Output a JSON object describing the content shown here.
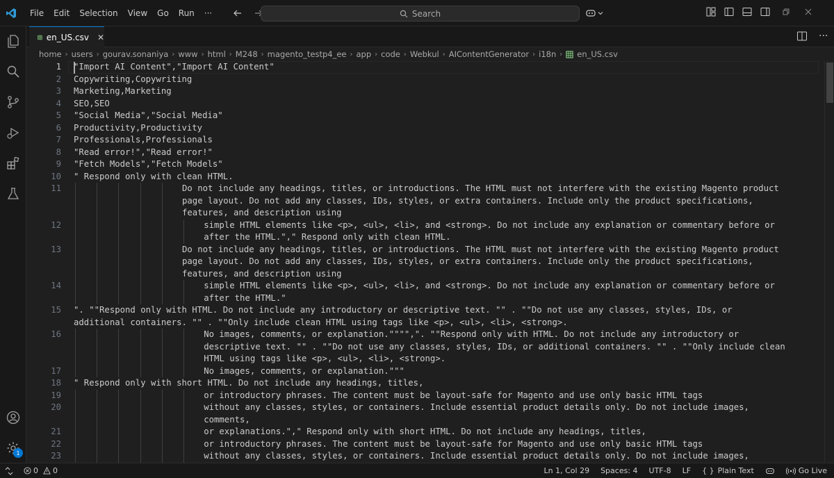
{
  "titlebar": {
    "menu": [
      "File",
      "Edit",
      "Selection",
      "View",
      "Go",
      "Run",
      "···"
    ],
    "search_placeholder": "Search"
  },
  "tab": {
    "label": "en_US.csv",
    "close": "✕"
  },
  "breadcrumb": [
    "home",
    "users",
    "gourav.sonaniya",
    "www",
    "html",
    "M248",
    "magento_testp4_ee",
    "app",
    "code",
    "Webkul",
    "AIContentGenerator",
    "i18n",
    "en_US.csv"
  ],
  "editor": {
    "rows": [
      {
        "num": "1",
        "text": "\"Import AI Content\",\"Import AI Content\"",
        "indent": 0
      },
      {
        "num": "2",
        "text": "Copywriting,Copywriting",
        "indent": 0
      },
      {
        "num": "3",
        "text": "Marketing,Marketing",
        "indent": 0
      },
      {
        "num": "4",
        "text": "SEO,SEO",
        "indent": 0
      },
      {
        "num": "5",
        "text": "\"Social Media\",\"Social Media\"",
        "indent": 0
      },
      {
        "num": "6",
        "text": "Productivity,Productivity",
        "indent": 0
      },
      {
        "num": "7",
        "text": "Professionals,Professionals",
        "indent": 0
      },
      {
        "num": "8",
        "text": "\"Read error!\",\"Read error!\"",
        "indent": 0
      },
      {
        "num": "9",
        "text": "\"Fetch Models\",\"Fetch Models\"",
        "indent": 0
      },
      {
        "num": "10",
        "text": "\" Respond only with clean HTML.",
        "indent": 0
      },
      {
        "num": "11",
        "text": "Do not include any headings, titles, or introductions. The HTML must not interfere with the existing Magento product",
        "indent": 5
      },
      {
        "num": "",
        "text": "page layout. Do not add any classes, IDs, styles, or extra containers. Include only the product specifications,",
        "indent": 5
      },
      {
        "num": "",
        "text": "features, and description using",
        "indent": 5
      },
      {
        "num": "12",
        "text": "simple HTML elements like <p>, <ul>, <li>, and <strong>. Do not include any explanation or commentary before or",
        "indent": 6
      },
      {
        "num": "",
        "text": "after the HTML.\",\" Respond only with clean HTML.",
        "indent": 6
      },
      {
        "num": "13",
        "text": "Do not include any headings, titles, or introductions. The HTML must not interfere with the existing Magento product",
        "indent": 5
      },
      {
        "num": "",
        "text": "page layout. Do not add any classes, IDs, styles, or extra containers. Include only the product specifications,",
        "indent": 5
      },
      {
        "num": "",
        "text": "features, and description using",
        "indent": 5
      },
      {
        "num": "14",
        "text": "simple HTML elements like <p>, <ul>, <li>, and <strong>. Do not include any explanation or commentary before or",
        "indent": 6
      },
      {
        "num": "",
        "text": "after the HTML.\"",
        "indent": 6
      },
      {
        "num": "15",
        "text": "\". \"\"Respond only with HTML. Do not include any introductory or descriptive text. \"\" . \"\"Do not use any classes, styles, IDs, or",
        "indent": 0
      },
      {
        "num": "",
        "text": "additional containers. \"\" . \"\"Only include clean HTML using tags like <p>, <ul>, <li>, <strong>.",
        "indent": 0
      },
      {
        "num": "16",
        "text": "No images, comments, or explanation.\"\"\"\",\". \"\"Respond only with HTML. Do not include any introductory or",
        "indent": 6
      },
      {
        "num": "",
        "text": "descriptive text. \"\" . \"\"Do not use any classes, styles, IDs, or additional containers. \"\" . \"\"Only include clean",
        "indent": 6
      },
      {
        "num": "",
        "text": "HTML using tags like <p>, <ul>, <li>, <strong>.",
        "indent": 6
      },
      {
        "num": "17",
        "text": "No images, comments, or explanation.\"\"\"",
        "indent": 6
      },
      {
        "num": "18",
        "text": "\" Respond only with short HTML. Do not include any headings, titles,",
        "indent": 0
      },
      {
        "num": "19",
        "text": "or introductory phrases. The content must be layout-safe for Magento and use only basic HTML tags",
        "indent": 6
      },
      {
        "num": "20",
        "text": "without any classes, styles, or containers. Include essential product details only. Do not include images,",
        "indent": 6
      },
      {
        "num": "",
        "text": "comments,",
        "indent": 6
      },
      {
        "num": "21",
        "text": "or explanations.\",\" Respond only with short HTML. Do not include any headings, titles,",
        "indent": 6
      },
      {
        "num": "22",
        "text": "or introductory phrases. The content must be layout-safe for Magento and use only basic HTML tags",
        "indent": 6
      },
      {
        "num": "23",
        "text": "without any classes, styles, or containers. Include essential product details only. Do not include images,",
        "indent": 6
      }
    ]
  },
  "statusbar": {
    "errors": "0",
    "warnings": "0",
    "position": "Ln 1, Col 29",
    "spaces": "Spaces: 4",
    "encoding": "UTF-8",
    "eol": "LF",
    "language_braces": "{ }",
    "language": "Plain Text",
    "golive": "Go Live",
    "notifications_badge": "1"
  },
  "colors": {
    "accent": "#0078d4",
    "editor_bg": "#1f1f1f",
    "chrome_bg": "#181818",
    "csv_icon": "#89d185"
  }
}
